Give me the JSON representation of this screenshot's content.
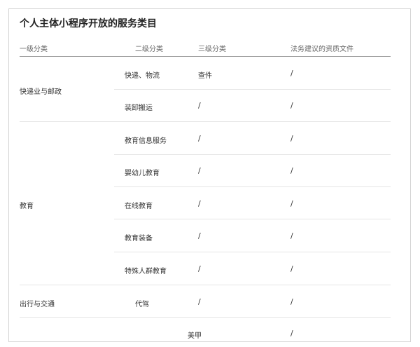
{
  "title": "个人主体小程序开放的服务类目",
  "headers": {
    "level1": "一级分类",
    "level2": "二级分类",
    "level3": "三级分类",
    "docs": "法务建议的资质文件"
  },
  "groups": [
    {
      "name": "快递业与邮政"
    },
    {
      "name": "教育"
    },
    {
      "name": "出行与交通"
    }
  ],
  "rows": [
    {
      "level2": "快递、物流",
      "level3": "查件",
      "docs": "/"
    },
    {
      "level2": "装卸搬运",
      "level3": "/",
      "docs": "/"
    },
    {
      "level2": "教育信息服务",
      "level3": "/",
      "docs": "/"
    },
    {
      "level2": "婴幼儿教育",
      "level3": "/",
      "docs": "/"
    },
    {
      "level2": "在线教育",
      "level3": "/",
      "docs": "/"
    },
    {
      "level2": "教育装备",
      "level3": "/",
      "docs": "/"
    },
    {
      "level2": "特殊人群教育",
      "level3": "/",
      "docs": "/"
    },
    {
      "level2": "代驾",
      "level3": "/",
      "docs": "/"
    },
    {
      "level2": "",
      "level3": "美甲",
      "docs": "/"
    }
  ]
}
